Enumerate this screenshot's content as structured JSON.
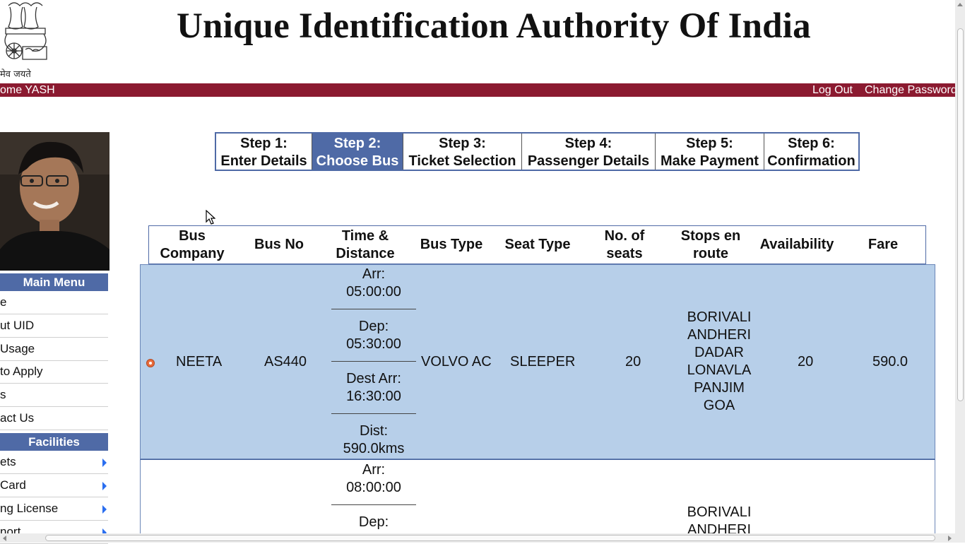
{
  "header": {
    "title": "Unique Identification Authority Of India",
    "motto": "मेव जयते",
    "emblem_icon": "national-emblem-icon"
  },
  "topbar": {
    "welcome": "ome YASH",
    "logout": "Log Out",
    "change_password": "Change Password",
    "color": "#8b1a30"
  },
  "sidebar": {
    "main_menu_title": "Main Menu",
    "main_items": [
      "e",
      "ut UID",
      "Usage",
      "to Apply",
      "s",
      "act Us"
    ],
    "facilities_title": "Facilities",
    "facility_items": [
      "ets",
      "Card",
      "ng License",
      "nort"
    ]
  },
  "steps": [
    {
      "line1": "Step 1:",
      "line2": "Enter Details",
      "active": false
    },
    {
      "line1": "Step 2:",
      "line2": "Choose Bus",
      "active": true
    },
    {
      "line1": "Step 3:",
      "line2": "Ticket Selection",
      "active": false
    },
    {
      "line1": "Step 4:",
      "line2": "Passenger Details",
      "active": false
    },
    {
      "line1": "Step 5:",
      "line2": "Make Payment",
      "active": false
    },
    {
      "line1": "Step 6:",
      "line2": "Confirmation",
      "active": false
    }
  ],
  "table": {
    "headers": [
      "Bus\nCompany",
      "Bus No",
      "Time &\nDistance",
      "Bus Type",
      "Seat Type",
      "No. of\nseats",
      "Stops en\nroute",
      "Availability",
      "Fare"
    ],
    "rows": [
      {
        "selected": true,
        "company": "NEETA",
        "bus_no": "AS440",
        "arr_label": "Arr:",
        "arr": "05:00:00",
        "dep_label": "Dep:",
        "dep": "05:30:00",
        "dest_label": "Dest Arr:",
        "dest": "16:30:00",
        "dist_label": "Dist:",
        "dist": "590.0kms",
        "bus_type": "VOLVO AC",
        "seat_type": "SLEEPER",
        "seats": "20",
        "stops": [
          "BORIVALI",
          "ANDHERI",
          "DADAR",
          "LONAVLA",
          "PANJIM",
          "GOA"
        ],
        "availability": "20",
        "fare": "590.0"
      },
      {
        "selected": false,
        "arr_label": "Arr:",
        "arr": "08:00:00",
        "dep_label": "Dep:",
        "stops": [
          "BORIVALI",
          "ANDHERI"
        ]
      }
    ]
  },
  "colors": {
    "accent": "#4f6aa6",
    "selected_row": "#b7cfe9"
  }
}
